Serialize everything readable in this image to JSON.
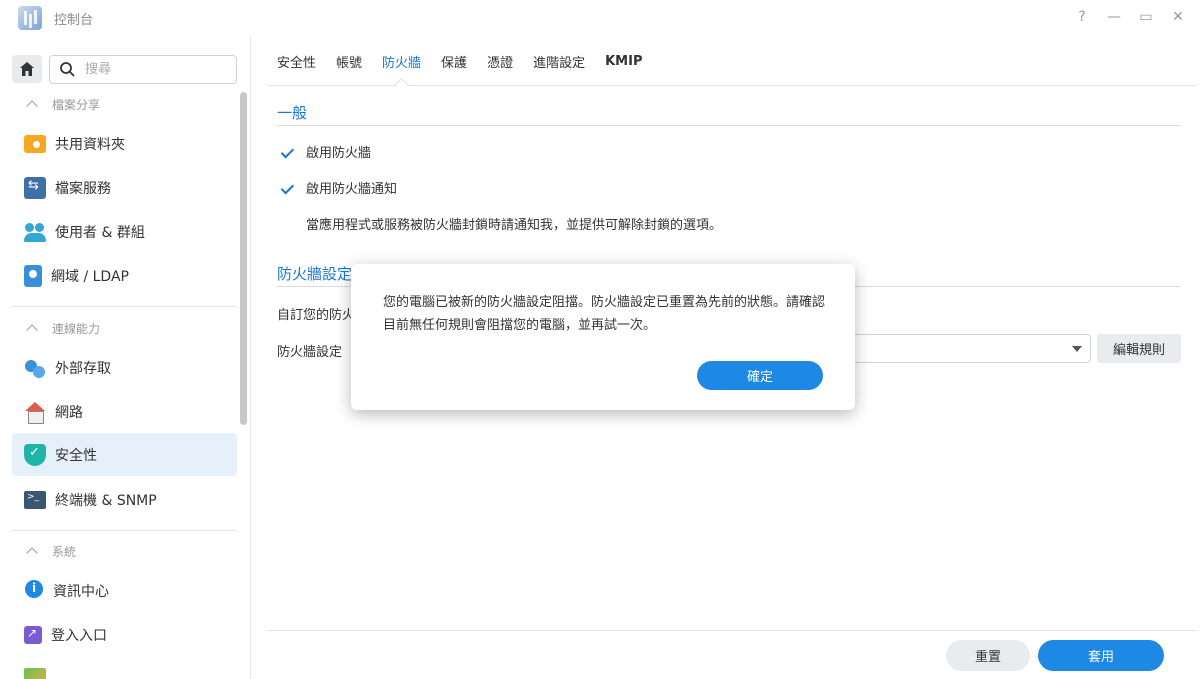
{
  "window": {
    "title": "控制台",
    "controls": {
      "help": "?",
      "minimize": "—",
      "maximize": "▭",
      "close": "✕"
    }
  },
  "sidebar": {
    "search_placeholder": "搜尋",
    "sections": [
      {
        "label": "檔案分享",
        "items": [
          {
            "label": "共用資料夾",
            "icon": "folder-icon"
          },
          {
            "label": "檔案服務",
            "icon": "file-services-icon"
          },
          {
            "label": "使用者 & 群組",
            "icon": "users-icon"
          },
          {
            "label": "網域 / LDAP",
            "icon": "ldap-icon"
          }
        ]
      },
      {
        "label": "連線能力",
        "items": [
          {
            "label": "外部存取",
            "icon": "external-access-icon"
          },
          {
            "label": "網路",
            "icon": "network-icon"
          },
          {
            "label": "安全性",
            "icon": "shield-icon",
            "active": true
          },
          {
            "label": "終端機 & SNMP",
            "icon": "terminal-icon"
          }
        ]
      },
      {
        "label": "系統",
        "items": [
          {
            "label": "資訊中心",
            "icon": "info-icon"
          },
          {
            "label": "登入入口",
            "icon": "login-portal-icon"
          }
        ]
      }
    ]
  },
  "tabs": [
    {
      "label": "安全性"
    },
    {
      "label": "帳號"
    },
    {
      "label": "防火牆",
      "active": true
    },
    {
      "label": "保護"
    },
    {
      "label": "憑證"
    },
    {
      "label": "進階設定"
    },
    {
      "label": "KMIP"
    }
  ],
  "general": {
    "title": "一般",
    "enable_firewall": {
      "label": "啟用防火牆",
      "checked": true
    },
    "enable_notification": {
      "label": "啟用防火牆通知",
      "checked": true
    },
    "notification_desc": "當應用程式或服務被防火牆封鎖時請通知我，並提供可解除封鎖的選項。"
  },
  "firewall_settings": {
    "title": "防火牆設定",
    "customize_label": "自訂您的防火",
    "profile_label": "防火牆設定",
    "edit_rules": "編輯規則"
  },
  "footer": {
    "reset": "重置",
    "apply": "套用"
  },
  "dialog": {
    "message": "您的電腦已被新的防火牆設定阻擋。防火牆設定已重置為先前的狀態。請確認目前無任何規則會阻擋您的電腦，並再試一次。",
    "ok": "確定"
  },
  "colors": {
    "accent": "#1e88e5",
    "active_tab": "#1b78d2",
    "active_sidebar_bg": "#e6f0fb"
  }
}
